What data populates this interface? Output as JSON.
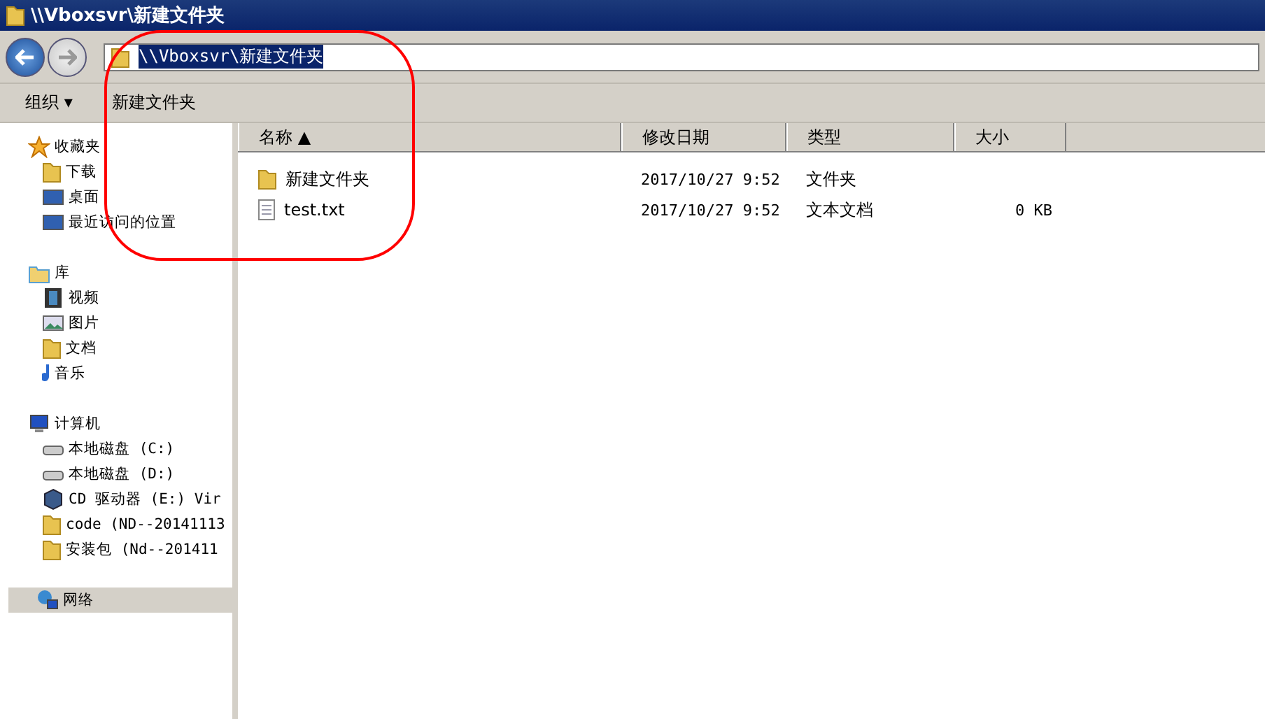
{
  "window": {
    "title": "\\\\Vboxsvr\\新建文件夹"
  },
  "address_bar": {
    "value": "\\\\Vboxsvr\\新建文件夹"
  },
  "toolbar": {
    "items": [
      "组织 ▾",
      "新建文件夹"
    ]
  },
  "sidebar": {
    "groups": [
      {
        "label": "收藏夹",
        "selected": false,
        "children": [
          {
            "label": "下载",
            "selected": false
          },
          {
            "label": "桌面",
            "selected": false
          },
          {
            "label": "最近访问的位置",
            "selected": false
          }
        ]
      },
      {
        "label": "库",
        "selected": false,
        "children": [
          {
            "label": "视频",
            "selected": false
          },
          {
            "label": "图片",
            "selected": false
          },
          {
            "label": "文档",
            "selected": false
          },
          {
            "label": "音乐",
            "selected": false
          }
        ]
      },
      {
        "label": "计算机",
        "selected": false,
        "children": [
          {
            "label": "本地磁盘 (C:)",
            "selected": false
          },
          {
            "label": "本地磁盘 (D:)",
            "selected": false
          },
          {
            "label": "CD 驱动器 (E:) Vir",
            "selected": false
          },
          {
            "label": "code (ND--20141113",
            "selected": false
          },
          {
            "label": "安装包 (Nd--201411",
            "selected": false
          }
        ]
      },
      {
        "label": "网络",
        "selected": true
      }
    ]
  },
  "table": {
    "columns": [
      "名称 ▲",
      "修改日期",
      "类型",
      "大小"
    ],
    "rows": [
      {
        "name": "新建文件夹",
        "modified": "2017/10/27 9:52",
        "type": "文件夹",
        "size": ""
      },
      {
        "name": "test.txt",
        "modified": "2017/10/27 9:52",
        "type": "文本文档",
        "size": "0 KB"
      }
    ]
  }
}
